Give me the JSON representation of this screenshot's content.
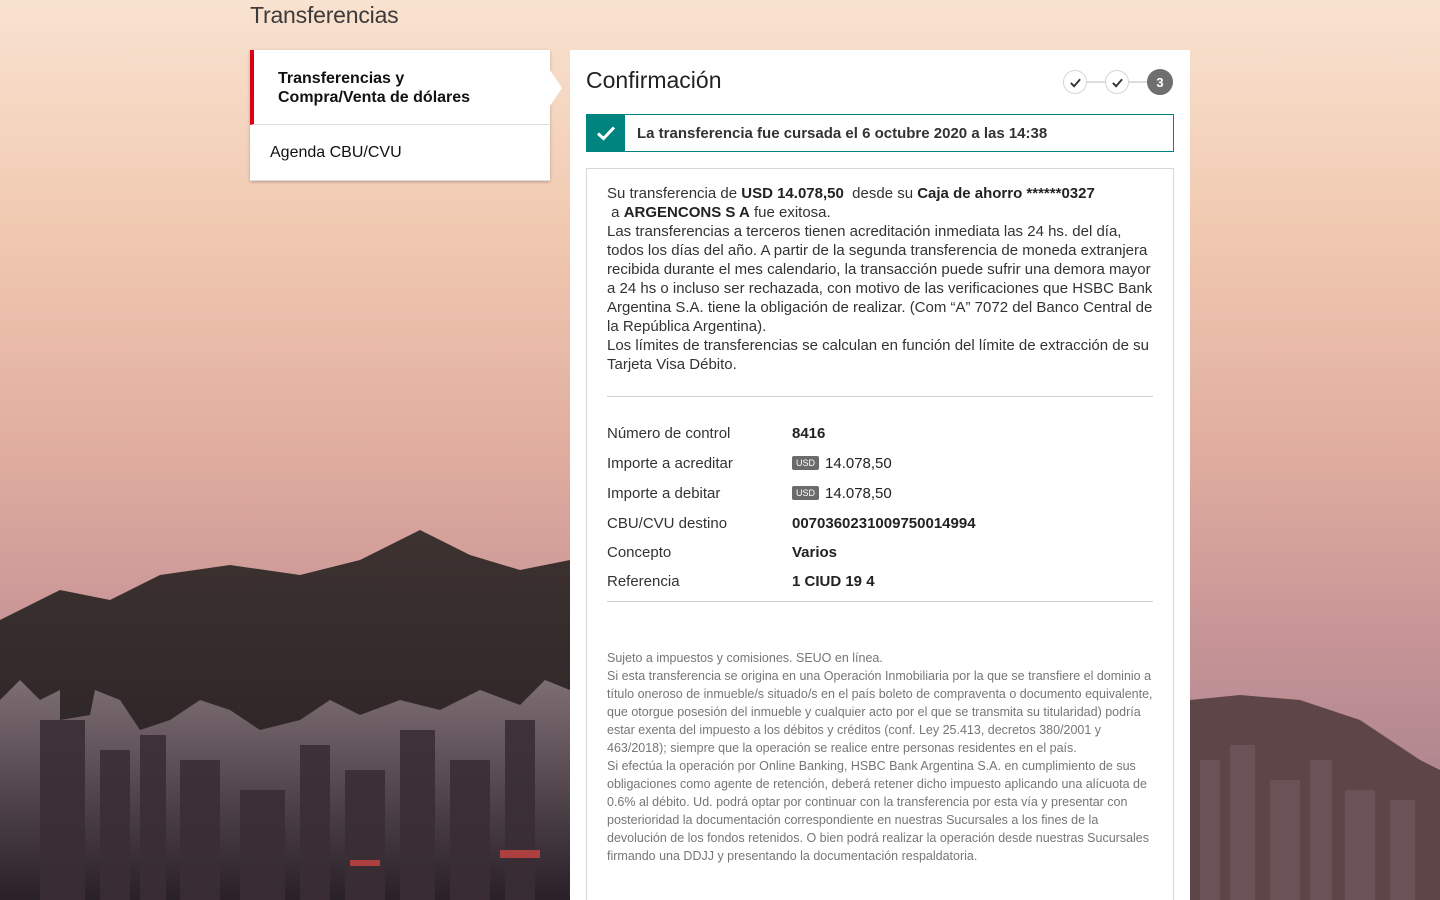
{
  "page": {
    "title": "Transferencias"
  },
  "sidebar": {
    "items": [
      {
        "label": "Transferencias y Compra/Venta de dólares",
        "active": true
      },
      {
        "label": "Agenda CBU/CVU",
        "active": false
      }
    ]
  },
  "panel": {
    "title": "Confirmación",
    "stepper": {
      "current_step": "3",
      "completed_steps": 2
    },
    "banner": {
      "text": "La transferencia fue cursada el 6 octubre 2020 a las 14:38",
      "color": "#00847f"
    },
    "summary": {
      "p1_a": "Su transferencia de ",
      "amount": "USD 14.078,50",
      "p1_b": "  desde su ",
      "account": "Caja de ahorro ******0327",
      "p1_c": " a ",
      "beneficiary": "ARGENCONS S A",
      "p1_d": " fue exitosa.",
      "p2": "Las transferencias a terceros tienen acreditación inmediata las 24 hs. del día, todos los días del año. A partir de la segunda transferencia de moneda extranjera recibida durante el mes calendario, la transacción puede sufrir una demora mayor a 24 hs o incluso ser rechazada, con motivo de las verificaciones que HSBC Bank Argentina S.A. tiene la obligación de realizar. (Com “A” 7072 del Banco Central de la República Argentina).",
      "p3": "Los límites de transferencias se calculan en función del límite de extracción de su Tarjeta Visa Débito."
    },
    "details": [
      {
        "label": "Número de control",
        "value": "8416",
        "currency": ""
      },
      {
        "label": "Importe a acreditar",
        "value": "14.078,50",
        "currency": "USD"
      },
      {
        "label": "Importe a debitar",
        "value": "14.078,50",
        "currency": "USD"
      },
      {
        "label": "CBU/CVU destino",
        "value": "0070360231009750014994",
        "currency": ""
      },
      {
        "label": "Concepto",
        "value": "Varios",
        "currency": ""
      },
      {
        "label": "Referencia",
        "value": "1 CIUD 19 4",
        "currency": ""
      }
    ],
    "legal": {
      "l1": "Sujeto a impuestos y comisiones. SEUO en línea.",
      "l2": "Si esta transferencia se origina en una Operación Inmobiliaria por la que se transfiere el dominio a título oneroso de inmueble/s situado/s en el país boleto de compraventa o documento equivalente, que otorgue posesión del inmueble y cualquier acto por el que se transmita su titularidad) podría estar exenta del impuesto a los débitos y créditos (conf. Ley 25.413, decretos 380/2001 y 463/2018); siempre que la operación se realice entre personas residentes en el país.",
      "l3": "Si efectúa la operación por Online Banking, HSBC Bank Argentina S.A. en cumplimiento de sus obligaciones como agente de retención, deberá retener dicho impuesto aplicando una alícuota de 0.6% al débito. Ud. podrá optar por continuar con la transferencia por esta vía y presentar con posterioridad la documentación correspondiente en nuestras Sucursales a los fines de la devolución de los fondos retenidos. O bien podrá realizar la operación desde nuestras Sucursales firmando una DDJJ y presentando la documentación respaldatoria."
    }
  },
  "colors": {
    "brand_red": "#db0011",
    "success_teal": "#00847f"
  }
}
